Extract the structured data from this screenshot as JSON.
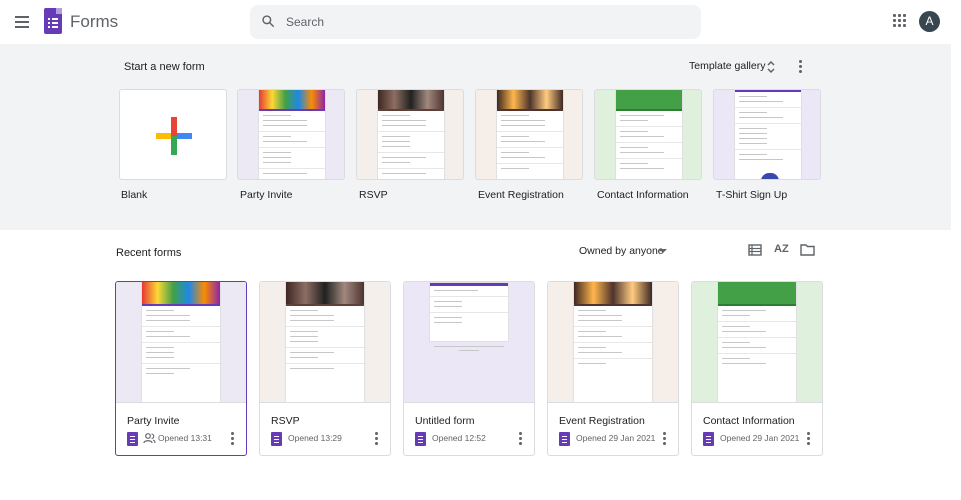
{
  "app": {
    "title": "Forms"
  },
  "search": {
    "placeholder": "Search"
  },
  "account": {
    "avatar_letter": "A"
  },
  "templates": {
    "heading": "Start a new form",
    "gallery_label": "Template gallery",
    "items": [
      {
        "label": "Blank"
      },
      {
        "label": "Party Invite"
      },
      {
        "label": "RSVP"
      },
      {
        "label": "Event Registration"
      },
      {
        "label": "Contact Information"
      },
      {
        "label": "T-Shirt Sign Up"
      }
    ]
  },
  "recent": {
    "heading": "Recent forms",
    "owner_filter": "Owned by anyone",
    "sort_label": "AZ",
    "forms": [
      {
        "title": "Party Invite",
        "opened": "Opened 13:31",
        "shared": true
      },
      {
        "title": "RSVP",
        "opened": "Opened 13:29",
        "shared": false
      },
      {
        "title": "Untitled form",
        "opened": "Opened 12:52",
        "shared": false
      },
      {
        "title": "Event Registration",
        "opened": "Opened 29 Jan 2021",
        "shared": false
      },
      {
        "title": "Contact Information",
        "opened": "Opened 29 Jan 2021",
        "shared": false
      }
    ]
  },
  "colors": {
    "brand": "#673ab7",
    "template_bg": "#f1f3f4",
    "party_bg": "#ece9f4",
    "rsvp_bg": "#f5efec",
    "event_bg": "#f6efe9",
    "contact_bg": "#dff0dc",
    "contact_banner": "#43a047",
    "tshirt_bg": "#ece7f7"
  }
}
